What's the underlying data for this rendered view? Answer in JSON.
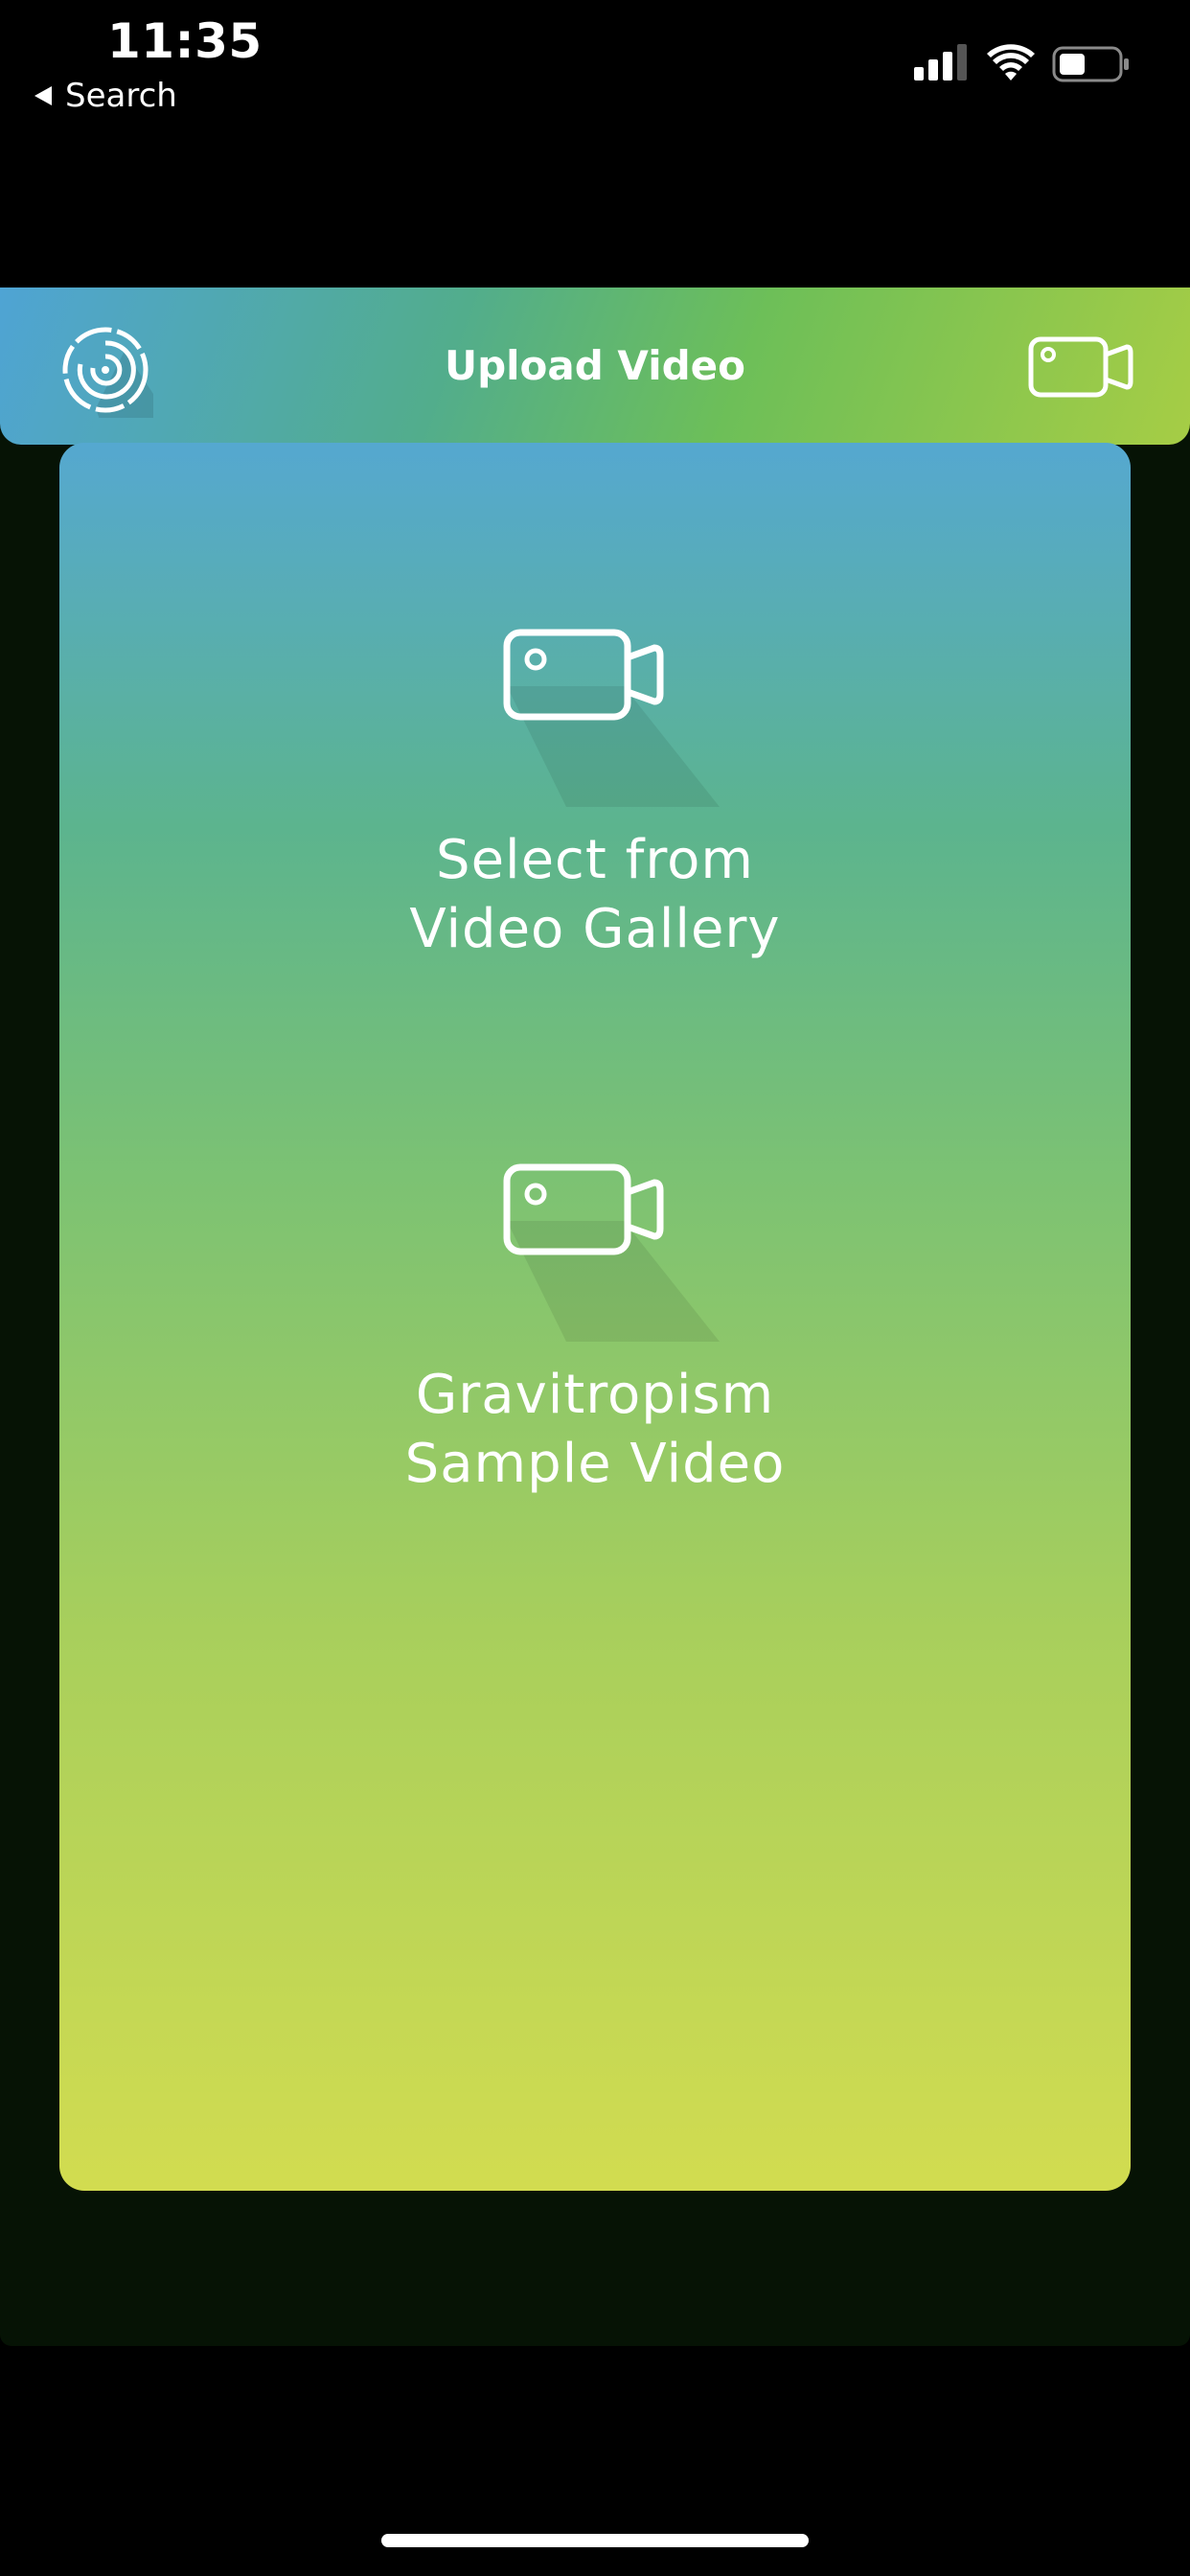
{
  "status_bar": {
    "time": "11:35",
    "back_label": "Search",
    "icons": [
      "signal-icon",
      "wifi-icon",
      "battery-icon"
    ]
  },
  "header": {
    "title": "Upload Video",
    "left_icon": "spiral-logo-icon",
    "right_icon": "video-camera-icon",
    "gradient": [
      "#4fa4d4",
      "#52ad8c",
      "#6dbf58",
      "#a6cd45"
    ]
  },
  "card": {
    "gradient": [
      "#55a8d0",
      "#5cb48e",
      "#7cc273",
      "#a8cf5c",
      "#d2dc50"
    ],
    "options": [
      {
        "label": "Select from\nVideo Gallery",
        "icon": "video-camera-icon"
      },
      {
        "label": "Gravitropism\nSample Video",
        "icon": "video-camera-icon"
      }
    ]
  },
  "colors": {
    "background": "#000000",
    "app_background": "#061305",
    "text": "#ffffff"
  }
}
